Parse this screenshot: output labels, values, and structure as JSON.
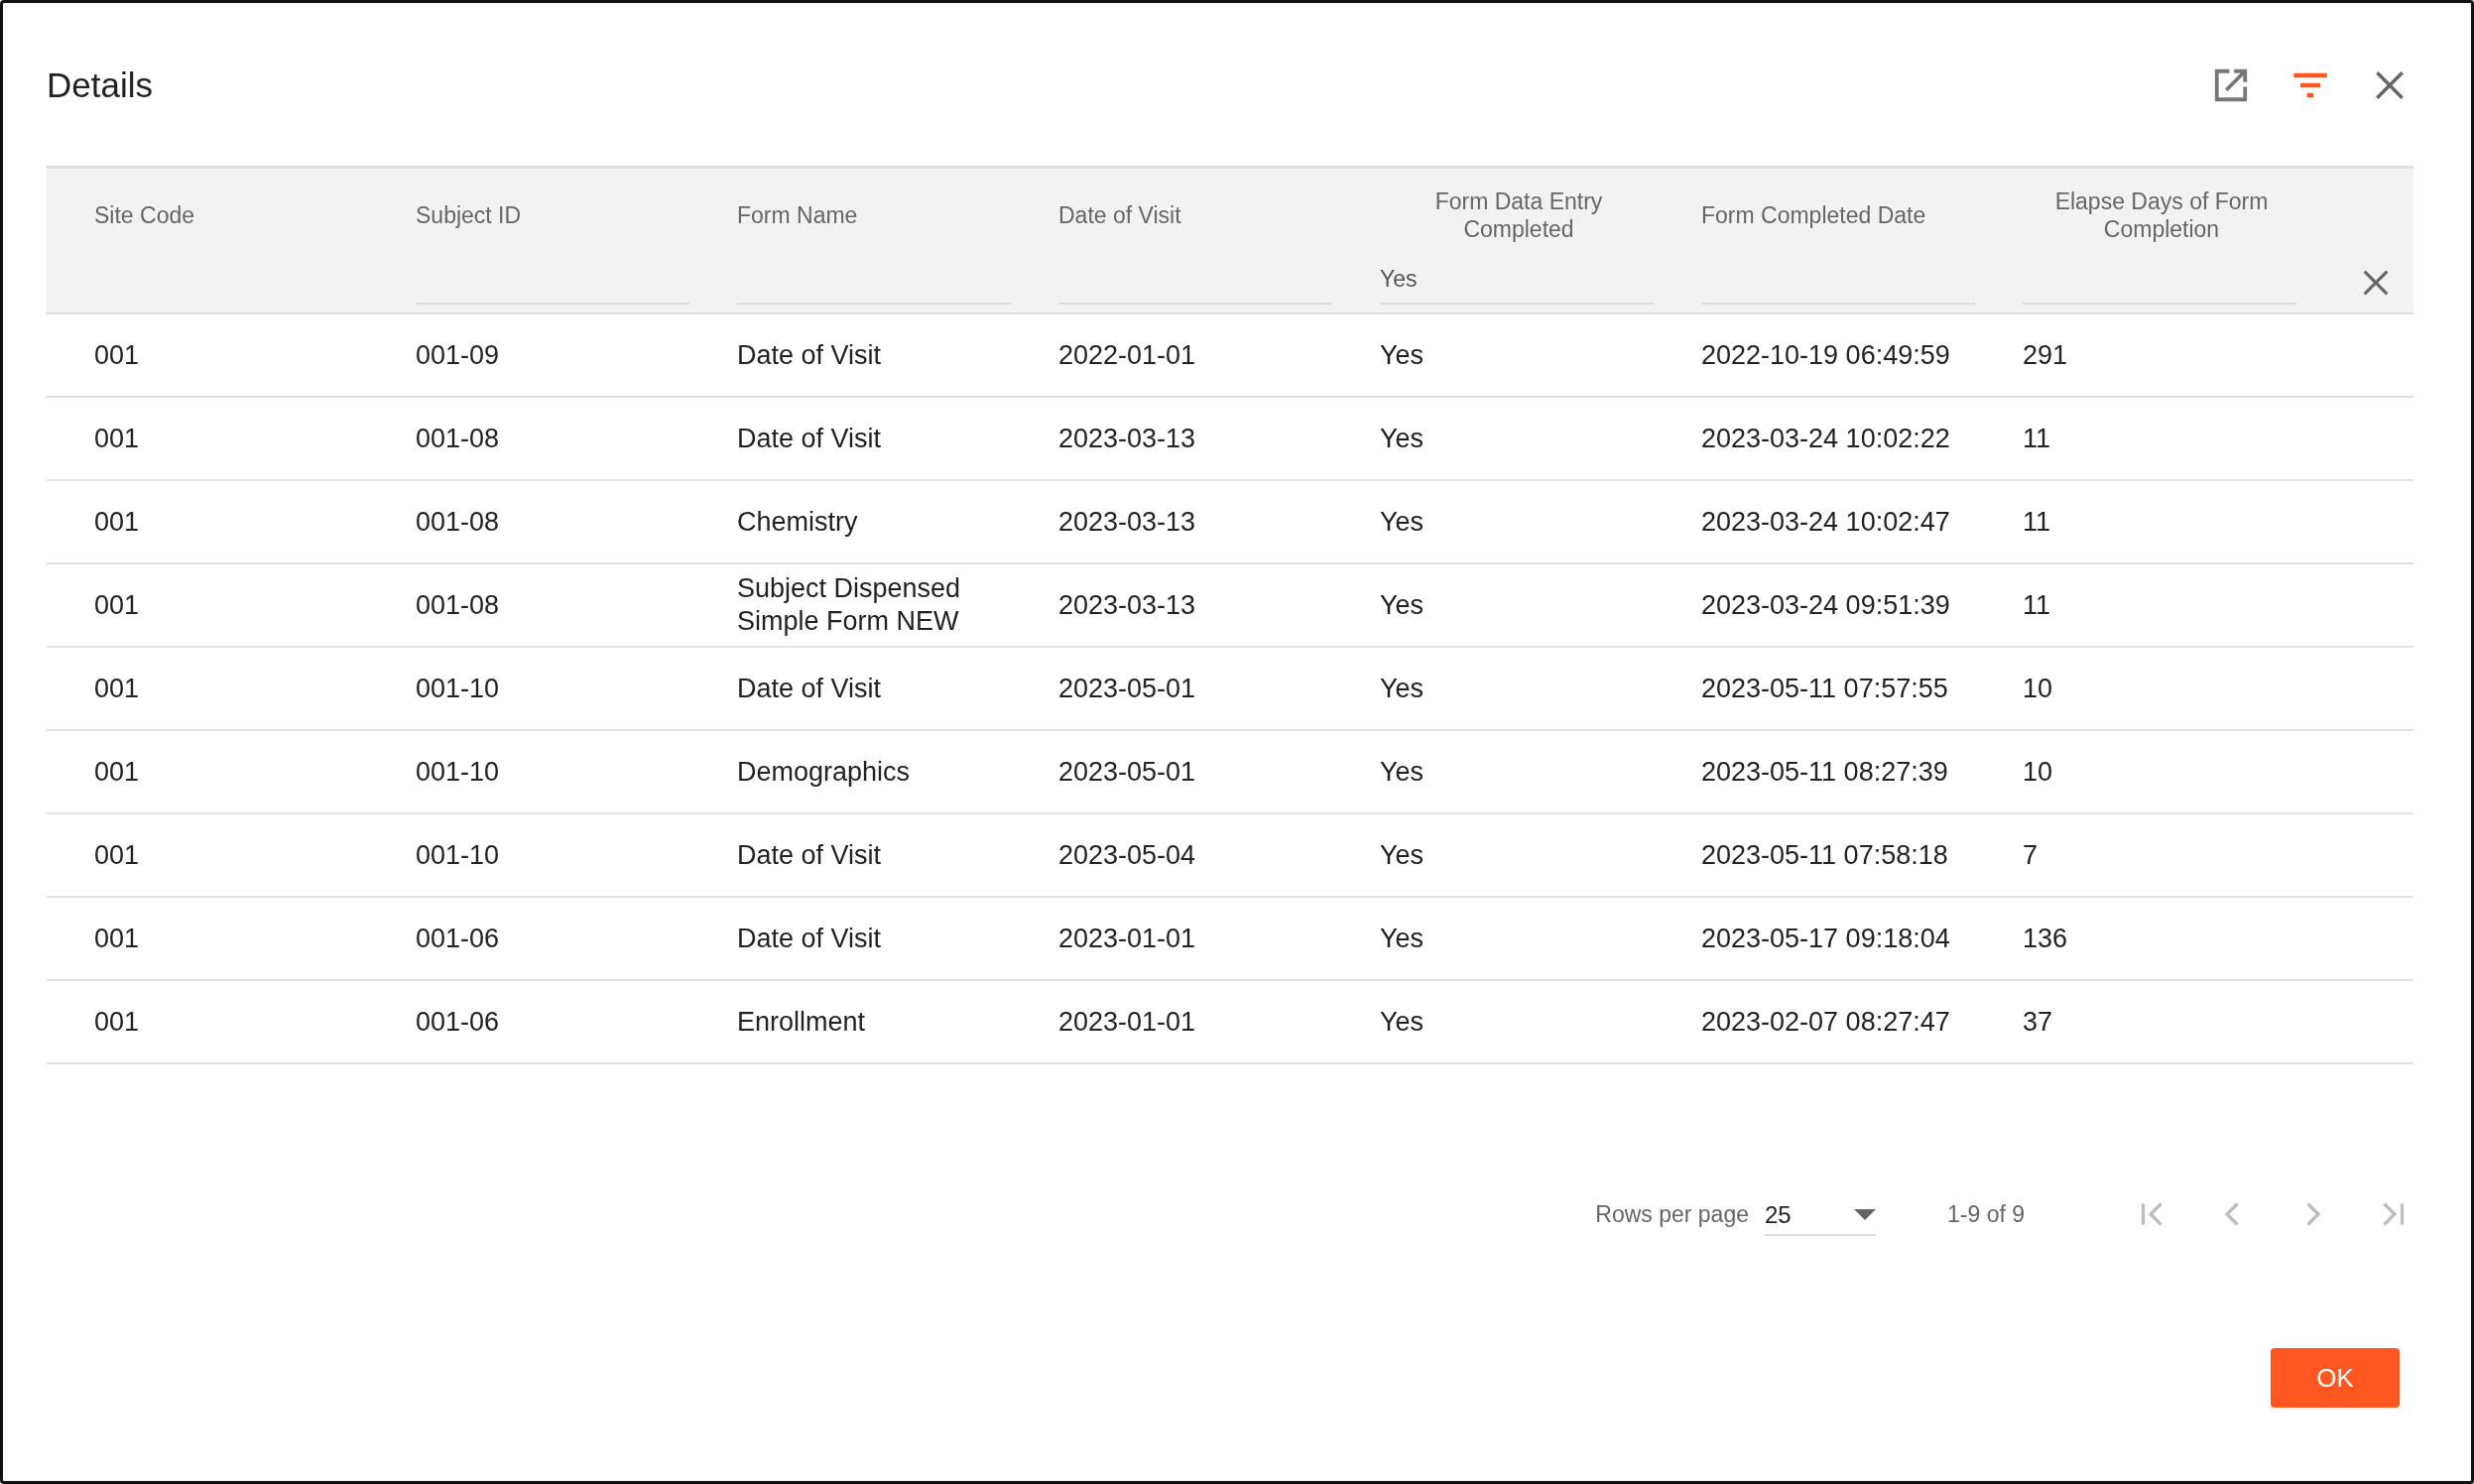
{
  "dialog": {
    "title": "Details",
    "filter_active": true
  },
  "table": {
    "columns": [
      {
        "label": "Site Code"
      },
      {
        "label": "Subject ID",
        "has_filter": true
      },
      {
        "label": "Form Name",
        "has_filter": true
      },
      {
        "label": "Date of Visit",
        "has_filter": true
      },
      {
        "label": "Form Data Entry Completed",
        "centered": true,
        "has_filter": true,
        "filter_value": "Yes"
      },
      {
        "label": "Form Completed Date",
        "has_filter": true
      },
      {
        "label": "Elapse Days of Form Completion",
        "centered": true,
        "has_filter": true
      }
    ],
    "rows": [
      [
        "001",
        "001-09",
        "Date of Visit",
        "2022-01-01",
        "Yes",
        "2022-10-19 06:49:59",
        "291"
      ],
      [
        "001",
        "001-08",
        "Date of Visit",
        "2023-03-13",
        "Yes",
        "2023-03-24 10:02:22",
        "11"
      ],
      [
        "001",
        "001-08",
        "Chemistry",
        "2023-03-13",
        "Yes",
        "2023-03-24 10:02:47",
        "11"
      ],
      [
        "001",
        "001-08",
        "Subject Dispensed Simple Form NEW",
        "2023-03-13",
        "Yes",
        "2023-03-24 09:51:39",
        "11"
      ],
      [
        "001",
        "001-10",
        "Date of Visit",
        "2023-05-01",
        "Yes",
        "2023-05-11 07:57:55",
        "10"
      ],
      [
        "001",
        "001-10",
        "Demographics",
        "2023-05-01",
        "Yes",
        "2023-05-11 08:27:39",
        "10"
      ],
      [
        "001",
        "001-10",
        "Date of Visit",
        "2023-05-04",
        "Yes",
        "2023-05-11 07:58:18",
        "7"
      ],
      [
        "001",
        "001-06",
        "Date of Visit",
        "2023-01-01",
        "Yes",
        "2023-05-17 09:18:04",
        "136"
      ],
      [
        "001",
        "001-06",
        "Enrollment",
        "2023-01-01",
        "Yes",
        "2023-02-07 08:27:47",
        "37"
      ]
    ]
  },
  "pagination": {
    "rows_per_page_label": "Rows per page",
    "rows_per_page": "25",
    "range": "1-9 of 9",
    "buttons": [
      {
        "kind": "first",
        "disabled": true
      },
      {
        "kind": "prev",
        "disabled": true
      },
      {
        "kind": "next",
        "disabled": true
      },
      {
        "kind": "last",
        "disabled": true
      }
    ]
  },
  "ok_button": "OK"
}
